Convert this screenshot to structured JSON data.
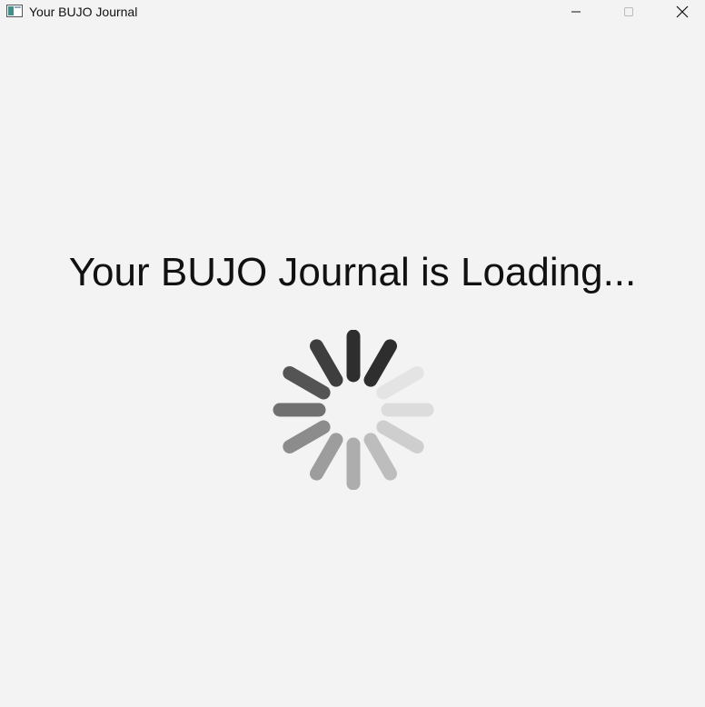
{
  "window": {
    "title": "Your BUJO Journal",
    "app_icon": "window-app-icon",
    "controls": {
      "minimize_icon": "minimize-icon",
      "maximize_icon": "maximize-icon",
      "close_icon": "close-icon"
    }
  },
  "main": {
    "loading_message": "Your BUJO Journal is Loading...",
    "spinner": {
      "icon": "loading-spinner-icon",
      "spoke_count": 12,
      "spoke_shades": [
        "#2e2e2e",
        "#2e2e2e",
        "#e4e4e4",
        "#dcdcdc",
        "#cecece",
        "#bdbdbd",
        "#adadad",
        "#9d9d9d",
        "#8c8c8c",
        "#707070",
        "#545454",
        "#3e3e3e"
      ]
    }
  }
}
